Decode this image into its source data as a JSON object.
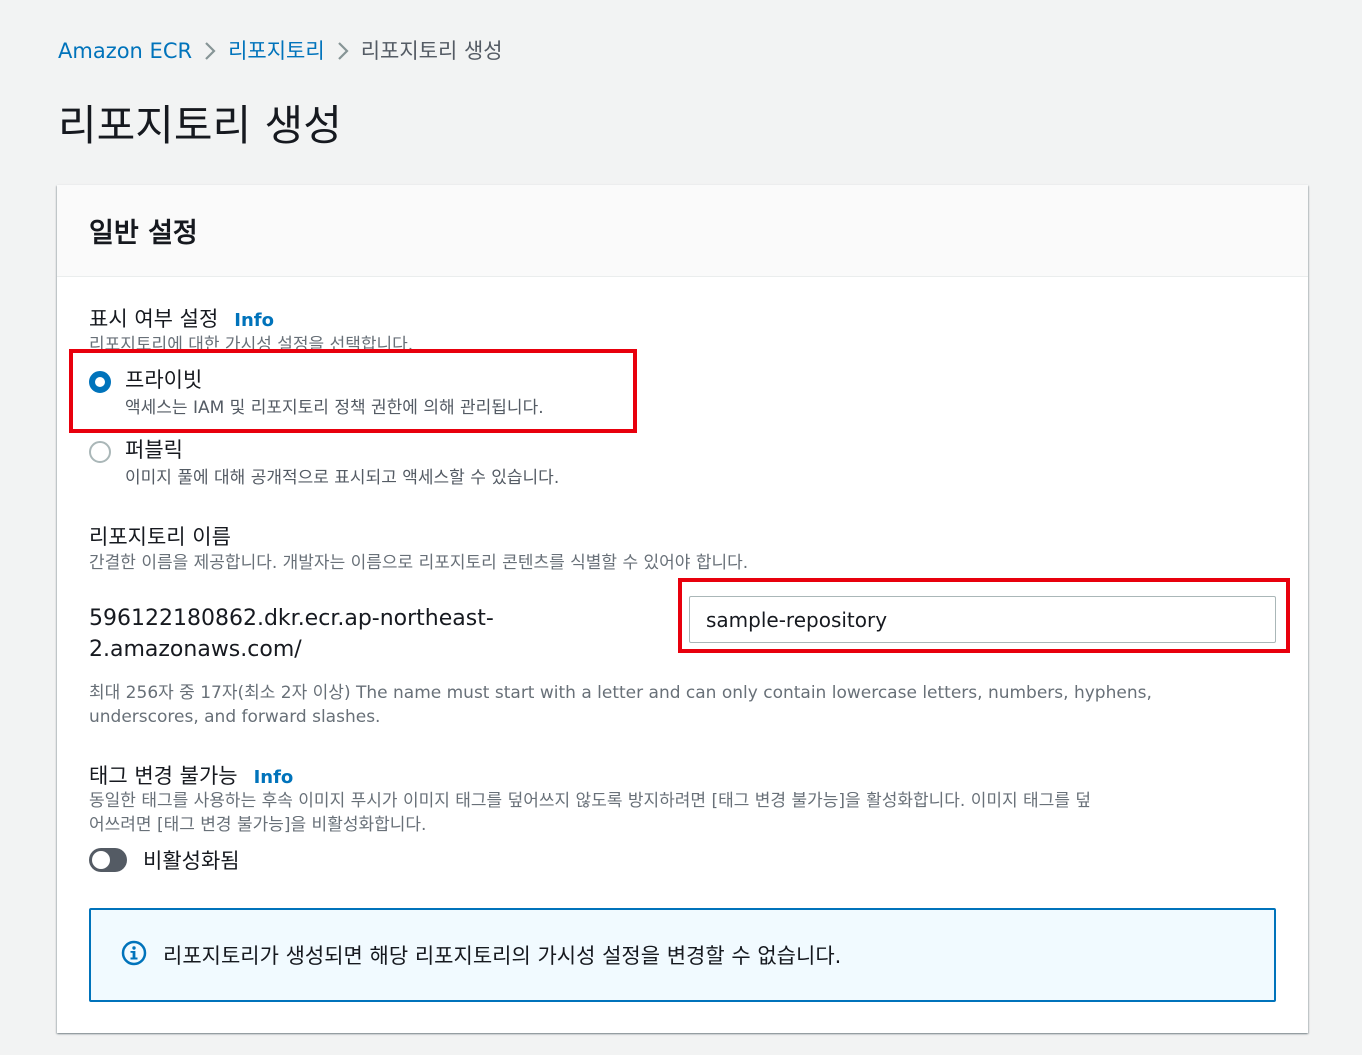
{
  "breadcrumb": {
    "items": [
      "Amazon ECR",
      "리포지토리"
    ],
    "current": "리포지토리 생성"
  },
  "page_title": "리포지토리 생성",
  "panel": {
    "title": "일반 설정"
  },
  "visibility": {
    "label": "표시 여부 설정",
    "info": "Info",
    "description": "리포지토리에 대한 가시성 설정을 선택합니다.",
    "options": [
      {
        "label": "프라이빗",
        "description": "액세스는 IAM 및 리포지토리 정책 권한에 의해 관리됩니다.",
        "selected": true
      },
      {
        "label": "퍼블릭",
        "description": "이미지 풀에 대해 공개적으로 표시되고 액세스할 수 있습니다.",
        "selected": false
      }
    ]
  },
  "repo_name": {
    "label": "리포지토리 이름",
    "description": "간결한 이름을 제공합니다. 개발자는 이름으로 리포지토리 콘텐츠를 식별할 수 있어야 합니다.",
    "prefix_line1": "596122180862.dkr.ecr.ap-northeast-",
    "prefix_line2": "2.amazonaws.com/",
    "value": "sample-repository",
    "hint_line1": "최대 256자 중 17자(최소 2자 이상) The name must start with a letter and can only contain lowercase letters, numbers, hyphens,",
    "hint_line2": "underscores, and forward slashes."
  },
  "tag_immutability": {
    "label": "태그 변경 불가능",
    "info": "Info",
    "description_line1": "동일한 태그를 사용하는 후속 이미지 푸시가 이미지 태그를 덮어쓰지 않도록 방지하려면 [태그 변경 불가능]을 활성화합니다. 이미지 태그를 덮",
    "description_line2": "어쓰려면 [태그 변경 불가능]을 비활성화합니다.",
    "toggle_label": "비활성화됨",
    "enabled": false
  },
  "alert": {
    "icon": "info-circle-icon",
    "text": "리포지토리가 생성되면 해당 리포지토리의 가시성 설정을 변경할 수 없습니다."
  },
  "colors": {
    "link": "#0073bb",
    "highlight": "#e8000d",
    "background": "#f2f3f3"
  }
}
